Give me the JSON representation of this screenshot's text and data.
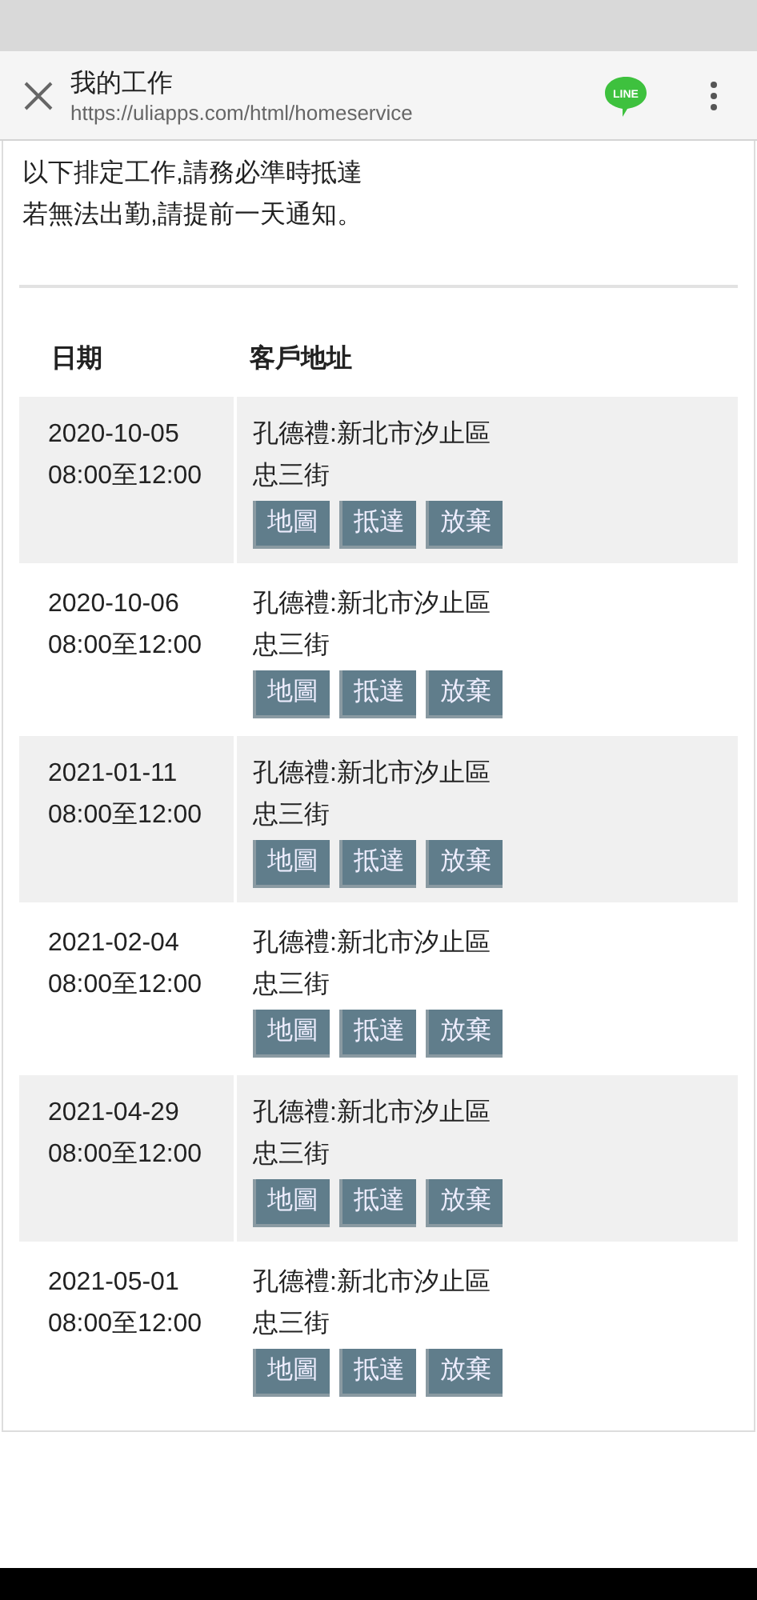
{
  "app_bar": {
    "title": "我的工作",
    "url": "https://uliapps.com/html/homeservice",
    "share_label": "LINE"
  },
  "notice": [
    "以下排定工作,請務必準時抵達",
    "若無法出勤,請提前一天通知。"
  ],
  "table": {
    "columns": [
      "日期",
      "客戶地址"
    ],
    "rows": [
      {
        "date": "2020-10-05",
        "time": "08:00至12:00",
        "address": [
          "孔德禮:新北市汐止區",
          "忠三街"
        ],
        "buttons": [
          "地圖",
          "抵達",
          "放棄"
        ]
      },
      {
        "date": "2020-10-06",
        "time": "08:00至12:00",
        "address": [
          "孔德禮:新北市汐止區",
          "忠三街"
        ],
        "buttons": [
          "地圖",
          "抵達",
          "放棄"
        ]
      },
      {
        "date": "2021-01-11",
        "time": "08:00至12:00",
        "address": [
          "孔德禮:新北市汐止區",
          "忠三街"
        ],
        "buttons": [
          "地圖",
          "抵達",
          "放棄"
        ]
      },
      {
        "date": "2021-02-04",
        "time": "08:00至12:00",
        "address": [
          "孔德禮:新北市汐止區",
          "忠三街"
        ],
        "buttons": [
          "地圖",
          "抵達",
          "放棄"
        ]
      },
      {
        "date": "2021-04-29",
        "time": "08:00至12:00",
        "address": [
          "孔德禮:新北市汐止區",
          "忠三街"
        ],
        "buttons": [
          "地圖",
          "抵達",
          "放棄"
        ]
      },
      {
        "date": "2021-05-01",
        "time": "08:00至12:00",
        "address": [
          "孔德禮:新北市汐止區",
          "忠三街"
        ],
        "buttons": [
          "地圖",
          "抵達",
          "放棄"
        ]
      }
    ]
  }
}
